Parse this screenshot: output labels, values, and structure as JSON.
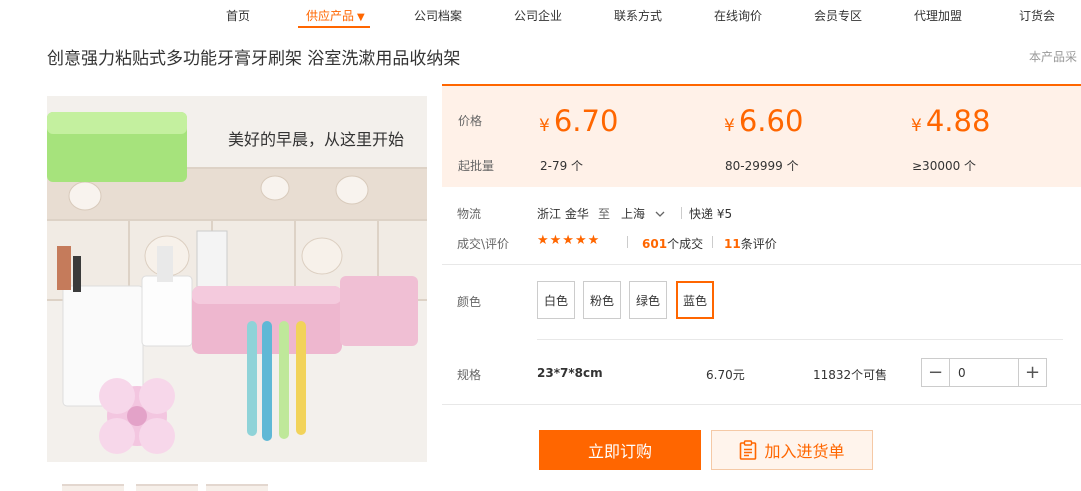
{
  "nav": {
    "items": [
      {
        "label": "首页"
      },
      {
        "label": "供应产品",
        "indicator": "▼"
      },
      {
        "label": "公司档案"
      },
      {
        "label": "公司企业"
      },
      {
        "label": "联系方式"
      },
      {
        "label": "在线询价"
      },
      {
        "label": "会员专区"
      },
      {
        "label": "代理加盟"
      },
      {
        "label": "订货会"
      }
    ],
    "accent_color": "#ff6600"
  },
  "product": {
    "title": "创意强力粘贴式多功能牙膏牙刷架 浴室洗漱用品收纳架",
    "side_note": "本产品采",
    "image_caption": "美好的早晨，从这里开始"
  },
  "price_panel": {
    "price_label": "价格",
    "moq_label": "起批量",
    "currency": "¥",
    "tiers": [
      {
        "price": "6.70",
        "range": "2-79 个"
      },
      {
        "price": "6.60",
        "range": "80-29999 个"
      },
      {
        "price": "4.88",
        "range": "≥30000 个"
      }
    ]
  },
  "logistics": {
    "label": "物流",
    "origin": "浙江 金华",
    "to": "至",
    "destination": "上海",
    "shipping": "快递 ¥5"
  },
  "reviews": {
    "label": "成交\\评价",
    "stars": "★★★★★",
    "deals_count": "601",
    "deals_suffix": "个成交",
    "review_count": "11",
    "review_suffix": "条评价"
  },
  "colors": {
    "label": "颜色",
    "options": [
      "白色",
      "粉色",
      "绿色",
      "蓝色"
    ],
    "selected": "蓝色"
  },
  "spec": {
    "label": "规格",
    "size": "23*7*8cm",
    "price": "6.70元",
    "stock": "11832个可售",
    "quantity": "0",
    "minus": "−",
    "plus": "+"
  },
  "actions": {
    "buy_label": "立即订购",
    "cart_label": "加入进货单"
  }
}
